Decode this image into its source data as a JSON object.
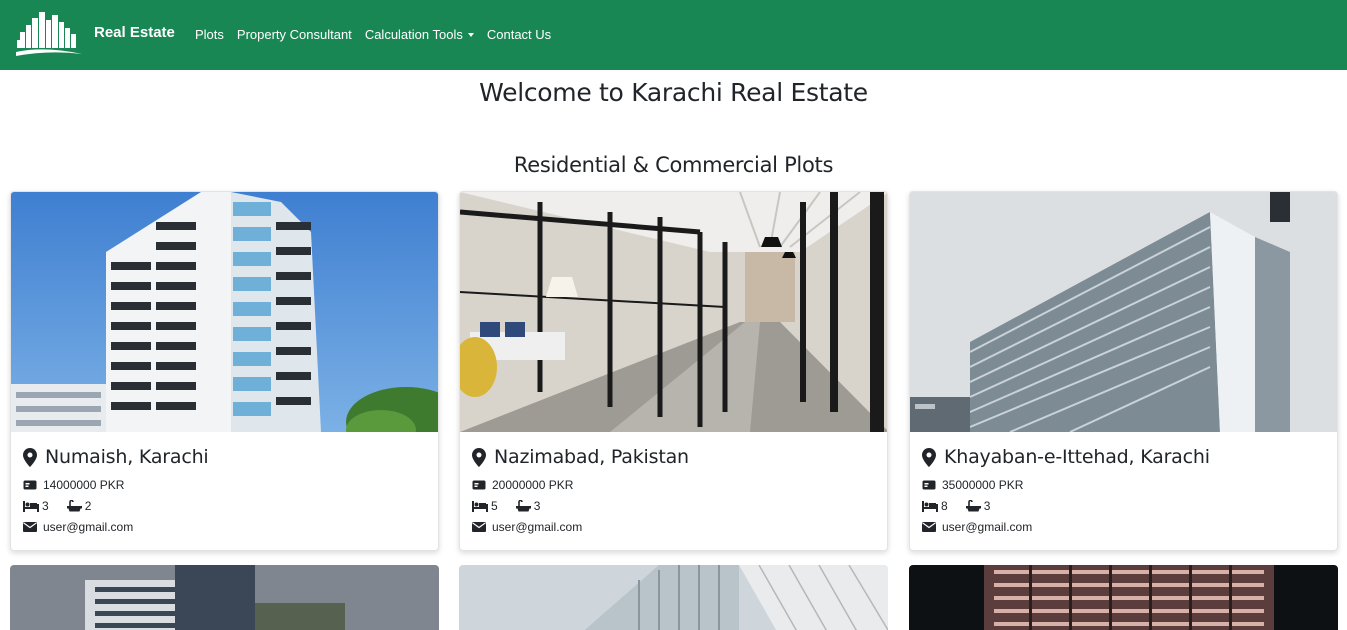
{
  "nav": {
    "brand": "Real Estate",
    "links": [
      {
        "label": "Plots"
      },
      {
        "label": "Property Consultant"
      },
      {
        "label": "Calculation Tools"
      },
      {
        "label": "Contact Us"
      }
    ]
  },
  "page_title": "Welcome to Karachi Real Estate",
  "section_title": "Residential & Commercial Plots",
  "colors": {
    "navbar": "#198754",
    "text": "#212529"
  },
  "cards": [
    {
      "location": "Numaish, Karachi",
      "price": "14000000 PKR",
      "beds": "3",
      "baths": "2",
      "email": "user@gmail.com"
    },
    {
      "location": "Nazimabad, Pakistan",
      "price": "20000000 PKR",
      "beds": "5",
      "baths": "3",
      "email": "user@gmail.com"
    },
    {
      "location": "Khayaban-e-Ittehad, Karachi",
      "price": "35000000 PKR",
      "beds": "8",
      "baths": "3",
      "email": "user@gmail.com"
    }
  ],
  "icons": {
    "location": "map-pin-icon",
    "price": "money-bill-icon",
    "beds": "bed-icon",
    "baths": "bath-icon",
    "email": "envelope-icon"
  }
}
